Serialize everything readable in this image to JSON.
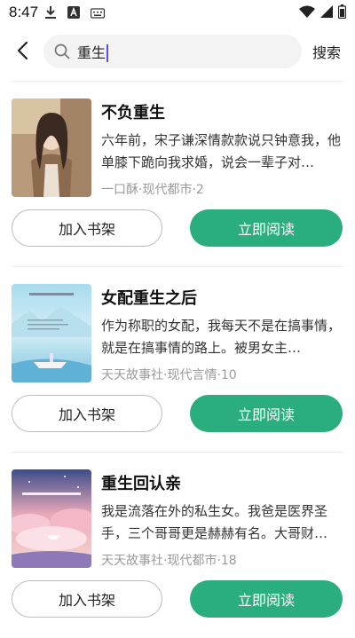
{
  "status_bar": {
    "time": "8:47",
    "left_icons": [
      "download-icon",
      "a-box-icon",
      "keyboard-icon"
    ],
    "right_icons": [
      "wifi-icon",
      "signal-icon",
      "battery-icon"
    ]
  },
  "search": {
    "query": "重生",
    "search_button_label": "搜索"
  },
  "results": [
    {
      "title": "不负重生",
      "description": "六年前，宋子谦深情款款说只钟意我，他单膝下跪向我求婚，说会一辈子对…",
      "meta": "一口酥·现代都市·2",
      "shelf_label": "加入书架",
      "read_label": "立即阅读"
    },
    {
      "title": "女配重生之后",
      "description": "作为称职的女配，我每天不是在搞事情，就是在搞事情的路上。被男女主…",
      "meta": "天天故事社·现代言情·10",
      "shelf_label": "加入书架",
      "read_label": "立即阅读"
    },
    {
      "title": "重生回认亲",
      "description": "我是流落在外的私生女。我爸是医界圣手，三个哥哥更是赫赫有名。大哥财…",
      "meta": "天天故事社·现代都市·18",
      "shelf_label": "加入书架",
      "read_label": "立即阅读"
    }
  ],
  "colors": {
    "accent": "#2aae7d",
    "caret": "#5a4cf0"
  }
}
